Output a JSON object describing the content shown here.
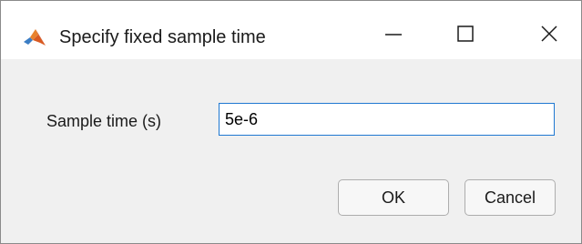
{
  "window": {
    "title": "Specify fixed sample time",
    "app_icon": "matlab-icon",
    "controls": {
      "minimize_icon": "minimize-icon",
      "maximize_icon": "maximize-icon",
      "close_icon": "close-icon"
    }
  },
  "form": {
    "sample_time_label": "Sample time (s)",
    "sample_time_value": "5e-6"
  },
  "buttons": {
    "ok_label": "OK",
    "cancel_label": "Cancel"
  },
  "colors": {
    "titlebar": "#ffffff",
    "content_bg": "#f0f0f0",
    "input_focus_border": "#1f78d1"
  }
}
